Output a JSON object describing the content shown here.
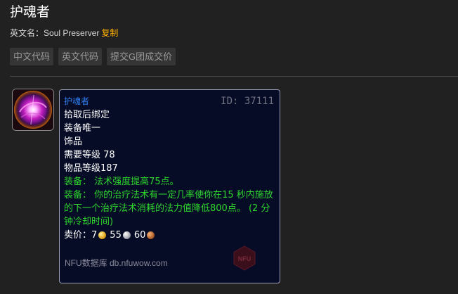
{
  "header": {
    "title": "护魂者",
    "english_name_label": "英文名：",
    "english_name": "Soul Preserver",
    "copy_label": "复制"
  },
  "actions": {
    "cn_code": "中文代码",
    "en_code": "英文代码",
    "submit_g_price": "提交G团成交价"
  },
  "item_icon": {
    "icon": "swirling-purple-orb-icon"
  },
  "tooltip": {
    "name": "护魂者",
    "id_text": "ID: 37111",
    "name_color": "#2f7df0",
    "lines": [
      "拾取后绑定",
      "装备唯一",
      "饰品",
      "需要等级 78",
      "物品等级187"
    ],
    "equip1": "装备： 法术强度提高75点。",
    "equip2": "装备： 你的治疗法术有一定几率使你在15 秒内施放的下一个治疗法术消耗的法力值降低800点。 (2 分钟冷却时间)",
    "equip_color": "#2dd52d",
    "price_label": "卖价：",
    "gold": "7",
    "silver": "55",
    "copper": "60",
    "footer": "NFU数据库 db.nfuwow.com",
    "logo_text": "NFU"
  }
}
